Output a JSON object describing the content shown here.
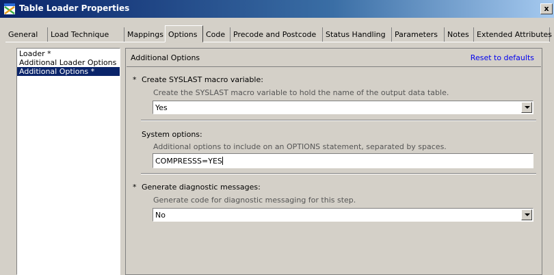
{
  "window": {
    "title": "Table Loader Properties",
    "close_glyph": "x",
    "icon": "table-loader-icon"
  },
  "tabs": [
    {
      "label": "General"
    },
    {
      "label": "Load Technique"
    },
    {
      "label": "Mappings"
    },
    {
      "label": "Options",
      "active": true
    },
    {
      "label": "Code"
    },
    {
      "label": "Precode and Postcode"
    },
    {
      "label": "Status Handling"
    },
    {
      "label": "Parameters"
    },
    {
      "label": "Notes"
    },
    {
      "label": "Extended Attributes"
    }
  ],
  "left_list": [
    {
      "label": "Loader *"
    },
    {
      "label": "Additional Loader Options"
    },
    {
      "label": "Additional Options *",
      "selected": true
    }
  ],
  "panel": {
    "title": "Additional Options",
    "reset_link": "Reset to defaults",
    "fields": {
      "syslast": {
        "required_mark": "*",
        "label": "Create SYSLAST macro variable:",
        "description": "Create the SYSLAST macro variable to hold the name of the output data table.",
        "value": "Yes"
      },
      "sysopts": {
        "label": "System options:",
        "description": "Additional options to include on an OPTIONS statement, separated by spaces.",
        "value": "COMPRESSS=YES"
      },
      "diag": {
        "required_mark": "*",
        "label": "Generate diagnostic messages:",
        "description": "Generate code for diagnostic messaging for this step.",
        "value": "No"
      }
    }
  },
  "colors": {
    "titlebar": "#0a246a",
    "selection": "#0a246a",
    "link": "#0000ee",
    "face": "#d4d0c8"
  }
}
